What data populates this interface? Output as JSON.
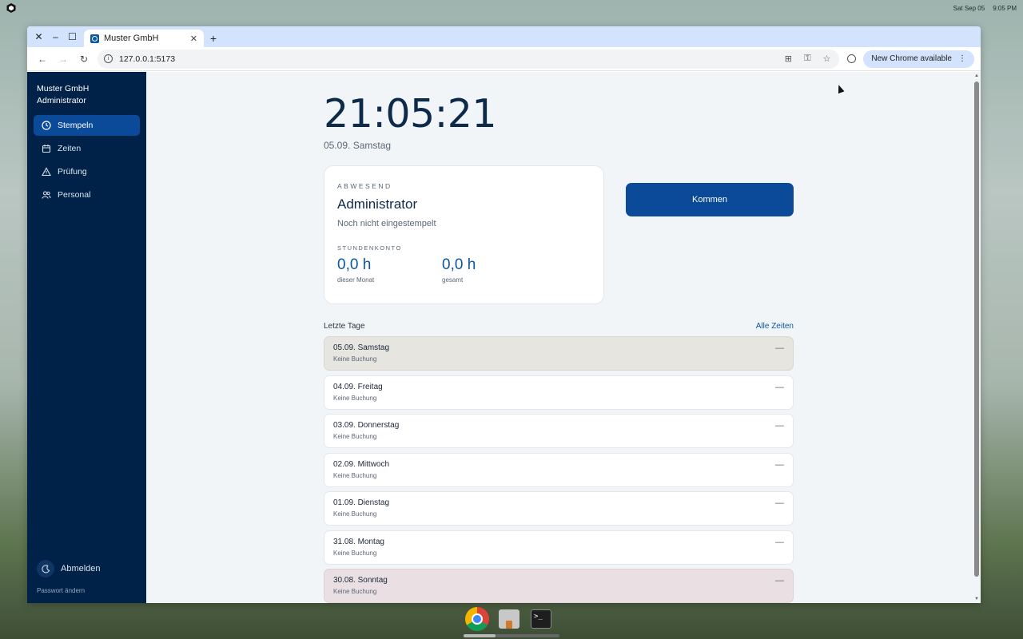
{
  "system": {
    "date": "Sat Sep 05",
    "time": "9:05 PM"
  },
  "browser": {
    "tab_title": "Muster GmbH",
    "url": "127.0.0.1:5173",
    "update_label": "New Chrome available"
  },
  "sidebar": {
    "org_name": "Muster GmbH",
    "user_role": "Administrator",
    "items": [
      {
        "label": "Stempeln",
        "icon": "clock-icon",
        "active": true
      },
      {
        "label": "Zeiten",
        "icon": "calendar-icon",
        "active": false
      },
      {
        "label": "Prüfung",
        "icon": "warning-icon",
        "active": false
      },
      {
        "label": "Personal",
        "icon": "users-icon",
        "active": false
      }
    ],
    "logout_label": "Abmelden",
    "password_label": "Passwort ändern"
  },
  "main": {
    "clock": "21:05:21",
    "date_line": "05.09. Samstag",
    "status": {
      "label": "ABWESEND",
      "name": "Administrator",
      "sub": "Noch nicht eingestempelt",
      "konto_label": "STUNDENKONTO",
      "month_value": "0,0 h",
      "month_caption": "dieser Monat",
      "total_value": "0,0 h",
      "total_caption": "gesamt"
    },
    "kommen_label": "Kommen",
    "days_title": "Letzte Tage",
    "all_times_label": "Alle Zeiten",
    "days": [
      {
        "date": "05.09. Samstag",
        "status": "Keine Buchung",
        "dash": "—",
        "kind": "today"
      },
      {
        "date": "04.09. Freitag",
        "status": "Keine Buchung",
        "dash": "—",
        "kind": "normal"
      },
      {
        "date": "03.09. Donnerstag",
        "status": "Keine Buchung",
        "dash": "—",
        "kind": "normal"
      },
      {
        "date": "02.09. Mittwoch",
        "status": "Keine Buchung",
        "dash": "—",
        "kind": "normal"
      },
      {
        "date": "01.09. Dienstag",
        "status": "Keine Buchung",
        "dash": "—",
        "kind": "normal"
      },
      {
        "date": "31.08. Montag",
        "status": "Keine Buchung",
        "dash": "—",
        "kind": "normal"
      },
      {
        "date": "30.08. Sonntag",
        "status": "Keine Buchung",
        "dash": "—",
        "kind": "sunday"
      }
    ]
  },
  "colors": {
    "sidebar_bg": "#012248",
    "accent": "#0b4a99",
    "today_row": "#e7e5df",
    "sunday_row": "#eadfe3"
  }
}
